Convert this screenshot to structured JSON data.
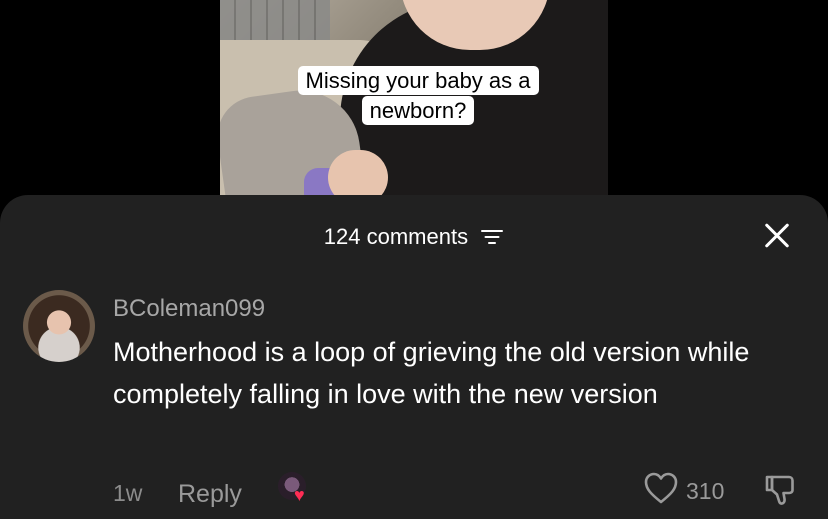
{
  "video": {
    "caption": "Missing your baby as a newborn?"
  },
  "sheet": {
    "comments_count_label": "124 comments",
    "icons": {
      "filter": "filter-lines-icon",
      "close": "close-icon"
    }
  },
  "comment": {
    "username": "BColeman099",
    "text": "Motherhood is a loop of grieving the old version while completely falling in love with the new version",
    "time": "1w",
    "reply_label": "Reply",
    "likes": "310",
    "icons": {
      "like": "heart-outline-icon",
      "dislike": "thumbs-down-icon",
      "creator_liked": "creator-liked-heart-icon"
    }
  },
  "colors": {
    "sheet_bg": "#212121",
    "text_muted": "#a7a7a7",
    "heart": "#ff2d55"
  }
}
